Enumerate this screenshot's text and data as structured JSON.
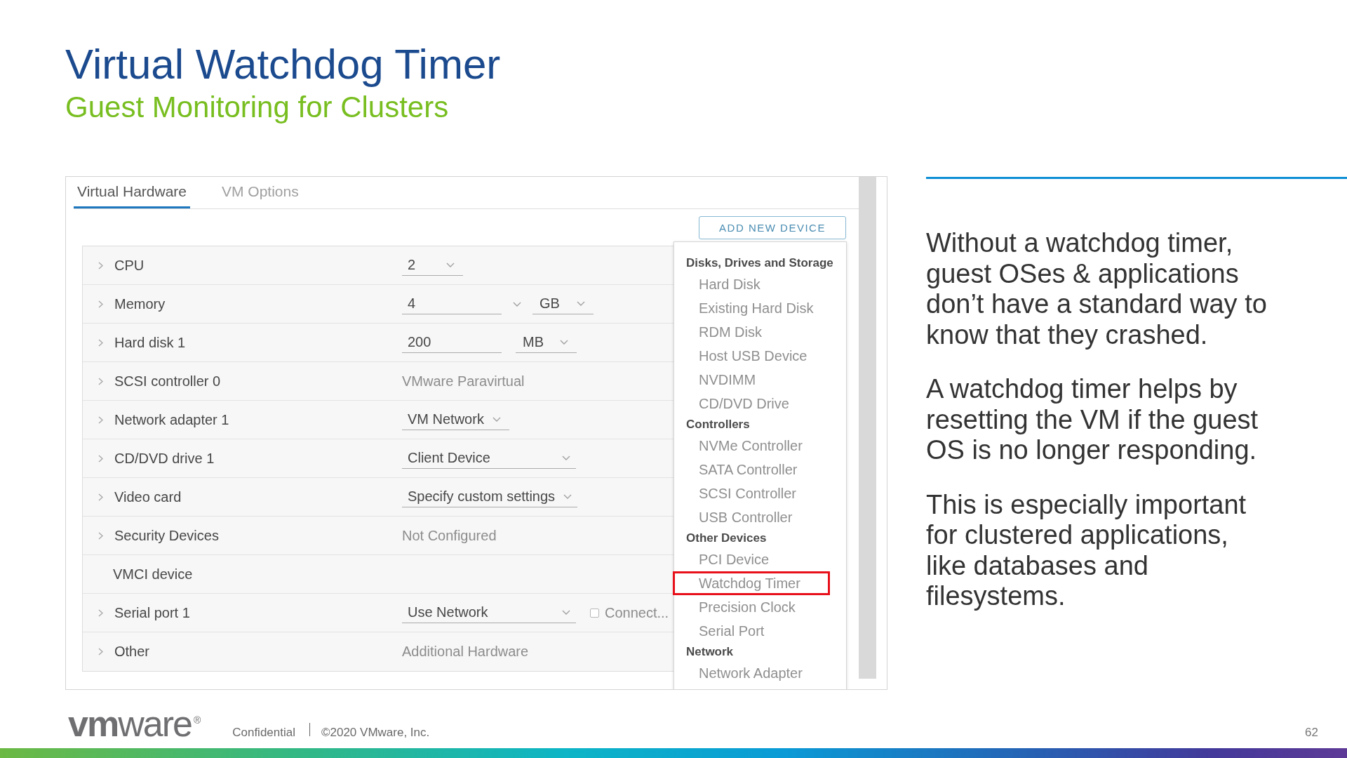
{
  "title": "Virtual Watchdog Timer",
  "subtitle": "Guest Monitoring for Clusters",
  "vm_settings": {
    "tabs": [
      {
        "label": "Virtual Hardware",
        "selected": true
      },
      {
        "label": "VM Options",
        "selected": false
      }
    ],
    "add_button": "ADD NEW DEVICE",
    "rows": [
      {
        "label": "CPU",
        "expandable": true,
        "kind": "select",
        "value": "2"
      },
      {
        "label": "Memory",
        "expandable": true,
        "kind": "combo_unit",
        "value": "4",
        "unit": "GB"
      },
      {
        "label": "Hard disk 1",
        "expandable": true,
        "kind": "input_unit",
        "value": "200",
        "unit": "MB"
      },
      {
        "label": "SCSI controller 0",
        "expandable": true,
        "kind": "text",
        "value": "VMware Paravirtual"
      },
      {
        "label": "Network adapter 1",
        "expandable": true,
        "kind": "select",
        "value": "VM Network"
      },
      {
        "label": "CD/DVD drive 1",
        "expandable": true,
        "kind": "select",
        "value": "Client Device"
      },
      {
        "label": "Video card",
        "expandable": true,
        "kind": "select",
        "value": "Specify custom settings"
      },
      {
        "label": "Security Devices",
        "expandable": true,
        "kind": "text",
        "value": "Not Configured"
      },
      {
        "label": "VMCI device",
        "expandable": false,
        "kind": "label_only"
      },
      {
        "label": "Serial port 1",
        "expandable": true,
        "kind": "select",
        "value": "Use Network",
        "checkbox": {
          "label": "Connect...",
          "checked": false
        }
      },
      {
        "label": "Other",
        "expandable": true,
        "kind": "text",
        "value": "Additional Hardware"
      }
    ],
    "menu": {
      "groups": [
        {
          "heading": "Disks, Drives and Storage",
          "items": [
            {
              "label": "Hard Disk",
              "highlighted": false
            },
            {
              "label": "Existing Hard Disk",
              "highlighted": false
            },
            {
              "label": "RDM Disk",
              "highlighted": false
            },
            {
              "label": "Host USB Device",
              "highlighted": false
            },
            {
              "label": "NVDIMM",
              "highlighted": false
            },
            {
              "label": "CD/DVD Drive",
              "highlighted": false
            }
          ]
        },
        {
          "heading": "Controllers",
          "items": [
            {
              "label": "NVMe Controller",
              "highlighted": false
            },
            {
              "label": "SATA Controller",
              "highlighted": false
            },
            {
              "label": "SCSI Controller",
              "highlighted": false
            },
            {
              "label": "USB Controller",
              "highlighted": false
            }
          ]
        },
        {
          "heading": "Other Devices",
          "items": [
            {
              "label": "PCI Device",
              "highlighted": false
            },
            {
              "label": "Watchdog Timer",
              "highlighted": true
            },
            {
              "label": "Precision Clock",
              "highlighted": false
            },
            {
              "label": "Serial Port",
              "highlighted": false
            }
          ]
        },
        {
          "heading": "Network",
          "items": [
            {
              "label": "Network Adapter",
              "highlighted": false
            }
          ]
        }
      ]
    }
  },
  "notes": [
    "Without a watchdog timer,\nguest OSes & applications\ndon’t have a standard way to\nknow that they crashed.",
    "A watchdog timer helps by\nresetting the VM if the guest\nOS is no longer responding.",
    "This is especially important\nfor clustered applications,\nlike databases and\nfilesystems."
  ],
  "footer": {
    "logo": "**vm**ware$^{®}$",
    "confidential": "Confidential",
    "copyright": "©2020 VMware, Inc.",
    "page_number": "62"
  }
}
